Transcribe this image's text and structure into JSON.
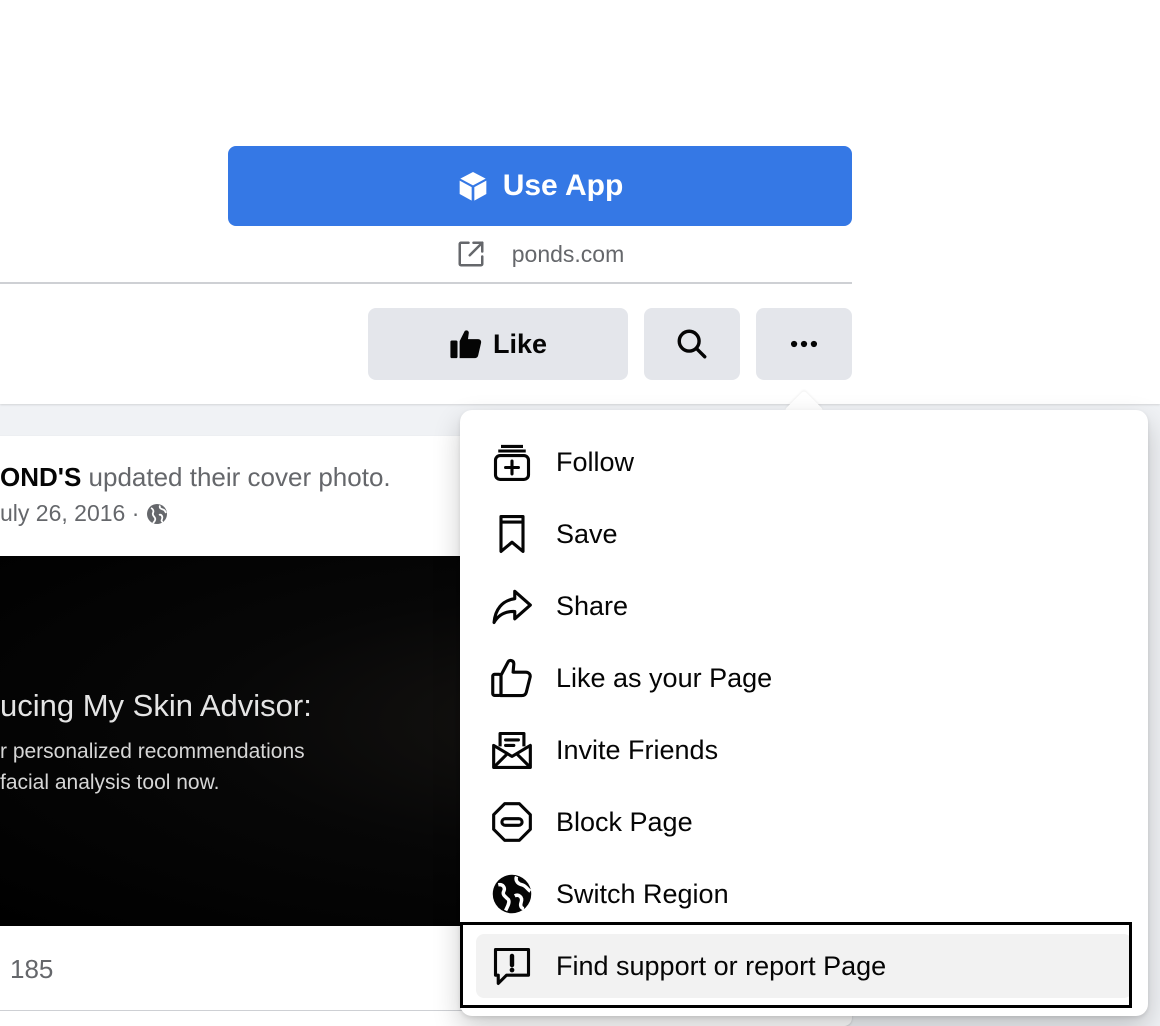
{
  "header": {
    "use_app_label": "Use App",
    "website": "ponds.com",
    "like_label": "Like"
  },
  "post": {
    "author": "OND'S",
    "action_text": " updated their cover photo.",
    "date": "uly 26, 2016 ·",
    "cover_headline": "ucing My Skin Advisor:",
    "cover_line1": "r personalized recommendations",
    "cover_line2": " facial analysis tool now.",
    "count": "185"
  },
  "menu": {
    "items": [
      {
        "label": "Follow",
        "icon": "follow-icon"
      },
      {
        "label": "Save",
        "icon": "bookmark-icon"
      },
      {
        "label": "Share",
        "icon": "share-icon"
      },
      {
        "label": "Like as your Page",
        "icon": "thumbs-up-icon"
      },
      {
        "label": "Invite Friends",
        "icon": "envelope-icon"
      },
      {
        "label": "Block Page",
        "icon": "block-icon"
      },
      {
        "label": "Switch Region",
        "icon": "globe-icon"
      },
      {
        "label": "Find support or report Page",
        "icon": "report-icon"
      }
    ],
    "selected_index": 7
  },
  "colors": {
    "primary_blue": "#3578e5",
    "button_gray": "#e4e6eb",
    "secondary_text": "#65676b"
  }
}
